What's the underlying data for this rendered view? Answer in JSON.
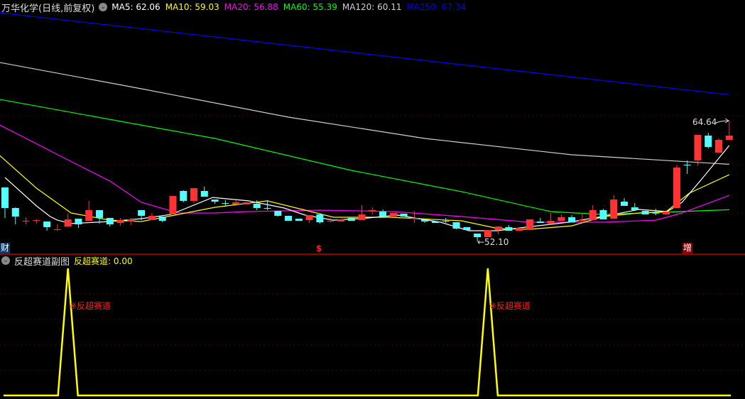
{
  "header": {
    "title": "万华化学(日线,前复权)",
    "ma": [
      {
        "label": "MA5: 62.06",
        "color": "#ffffff"
      },
      {
        "label": "MA10: 59.03",
        "color": "#ffff00"
      },
      {
        "label": "MA20: 56.88",
        "color": "#ff00ff"
      },
      {
        "label": "MA60: 55.39",
        "color": "#00ff00"
      },
      {
        "label": "MA120: 60.11",
        "color": "#d0d0d0"
      },
      {
        "label": "MA250: 67.34",
        "color": "#0000ff"
      }
    ]
  },
  "sub_header": {
    "title": "反超赛道副图",
    "indicator": "反超赛道: 0.00"
  },
  "markers": {
    "cai": "财",
    "dollar": "$",
    "zeng": "增"
  },
  "annotations": {
    "high": "64.64",
    "low": "←52.10",
    "signal_label": "※反超赛道"
  },
  "colors": {
    "up": "#ff3333",
    "down": "#54ffff",
    "grid": "#8b0000",
    "separator": "#c00000",
    "sub_line": "#ffff00"
  },
  "chart_data": {
    "type": "candlestick",
    "title": "万华化学(日线,前复权)",
    "price_range": [
      52.1,
      64.64
    ],
    "candles_ohlc": [
      [
        57.71,
        57.71,
        54.54,
        55.57
      ],
      [
        55.57,
        55.64,
        53.87,
        54.68
      ],
      [
        54.2,
        54.61,
        53.87,
        54.24
      ],
      [
        54.28,
        54.39,
        53.95,
        54.31
      ],
      [
        54.17,
        54.17,
        53.21,
        53.58
      ],
      [
        53.33,
        53.87,
        53.21,
        53.36
      ],
      [
        53.65,
        54.98,
        53.65,
        54.39
      ],
      [
        54.46,
        54.46,
        53.5,
        53.87
      ],
      [
        54.24,
        56.31,
        54.24,
        55.35
      ],
      [
        55.35,
        55.35,
        53.95,
        54.54
      ],
      [
        54.54,
        54.54,
        53.65,
        53.87
      ],
      [
        54.02,
        54.54,
        53.72,
        54.31
      ],
      [
        54.17,
        54.54,
        53.8,
        54.39
      ],
      [
        55.35,
        55.35,
        54.31,
        54.76
      ],
      [
        54.31,
        55.05,
        54.31,
        54.76
      ],
      [
        54.68,
        54.68,
        54.09,
        54.24
      ],
      [
        54.9,
        56.82,
        54.9,
        56.82
      ],
      [
        57.34,
        57.41,
        56.16,
        56.31
      ],
      [
        56.31,
        57.63,
        56.08,
        57.63
      ],
      [
        57.34,
        57.78,
        56.75,
        56.75
      ],
      [
        56.45,
        56.45,
        56.01,
        56.23
      ],
      [
        56.08,
        56.38,
        55.72,
        56.05
      ],
      [
        55.94,
        56.38,
        55.94,
        56.16
      ],
      [
        55.94,
        56.16,
        55.94,
        56.16
      ],
      [
        56.01,
        56.38,
        55.35,
        55.57
      ],
      [
        55.57,
        56.38,
        55.35,
        55.49
      ],
      [
        55.27,
        55.27,
        54.68,
        54.76
      ],
      [
        54.76,
        54.76,
        54.24,
        54.24
      ],
      [
        54.46,
        54.46,
        54.24,
        54.24
      ],
      [
        54.31,
        54.83,
        54.02,
        54.83
      ],
      [
        54.9,
        54.9,
        53.95,
        54.09
      ],
      [
        54.2,
        54.54,
        54.09,
        54.24
      ],
      [
        54.17,
        54.39,
        54.17,
        54.39
      ],
      [
        54.54,
        54.54,
        54.24,
        54.24
      ],
      [
        54.31,
        55.86,
        54.31,
        54.9
      ],
      [
        55.31,
        55.64,
        54.9,
        55.35
      ],
      [
        55.2,
        55.42,
        54.68,
        54.68
      ],
      [
        54.68,
        55.05,
        54.68,
        55.05
      ],
      [
        54.98,
        54.98,
        54.68,
        54.68
      ],
      [
        54.5,
        55.27,
        54.02,
        54.54
      ],
      [
        54.39,
        54.39,
        54.02,
        54.17
      ],
      [
        54.17,
        54.17,
        54.02,
        54.02
      ],
      [
        54.24,
        54.54,
        54.02,
        54.2
      ],
      [
        54.09,
        54.09,
        53.36,
        53.43
      ],
      [
        53.58,
        53.58,
        53.28,
        53.28
      ],
      [
        52.91,
        52.91,
        52.1,
        52.54
      ],
      [
        52.54,
        53.28,
        52.54,
        53.28
      ],
      [
        53.28,
        53.65,
        52.84,
        53.65
      ],
      [
        53.58,
        53.8,
        53.21,
        53.21
      ],
      [
        53.21,
        53.5,
        53.21,
        53.5
      ],
      [
        53.28,
        54.39,
        53.28,
        54.39
      ],
      [
        54.17,
        54.54,
        54.02,
        54.02
      ],
      [
        53.95,
        55.05,
        53.95,
        54.24
      ],
      [
        54.24,
        54.9,
        54.24,
        54.61
      ],
      [
        54.61,
        54.83,
        54.09,
        54.09
      ],
      [
        54.28,
        55.05,
        53.95,
        54.31
      ],
      [
        54.31,
        55.86,
        54.31,
        55.35
      ],
      [
        55.35,
        55.49,
        54.39,
        54.39
      ],
      [
        54.46,
        56.9,
        54.46,
        56.45
      ],
      [
        56.23,
        56.6,
        55.79,
        55.79
      ],
      [
        55.64,
        56.08,
        55.35,
        55.35
      ],
      [
        55.27,
        55.27,
        54.9,
        54.9
      ],
      [
        55.07,
        55.49,
        54.83,
        55.05
      ],
      [
        54.9,
        55.2,
        54.9,
        55.2
      ],
      [
        55.57,
        60.07,
        55.57,
        59.77
      ],
      [
        60.07,
        60.51,
        59.11,
        60.03
      ],
      [
        60.51,
        63.17,
        59.99,
        63.17
      ],
      [
        63.09,
        63.39,
        61.76,
        61.91
      ],
      [
        61.32,
        62.8,
        61.32,
        62.65
      ],
      [
        62.65,
        64.64,
        62.65,
        63.09
      ]
    ],
    "moving_averages": [
      {
        "name": "MA250",
        "color": "#0000ff",
        "points": [
          [
            -0.5,
            75.85
          ],
          [
            69,
            67.34
          ]
        ]
      },
      {
        "name": "MA120",
        "color": "#d0d0d0",
        "points": [
          [
            -0.5,
            70.69
          ],
          [
            13,
            67.96
          ],
          [
            27,
            65.01
          ],
          [
            40,
            62.8
          ],
          [
            54,
            61.1
          ],
          [
            69,
            60.11
          ]
        ]
      },
      {
        "name": "MA60",
        "color": "#00ff00",
        "points": [
          [
            -0.5,
            66.85
          ],
          [
            20,
            62.8
          ],
          [
            33,
            59.48
          ],
          [
            43.5,
            57.27
          ],
          [
            52,
            55.2
          ],
          [
            57,
            54.9
          ],
          [
            69,
            55.39
          ]
        ]
      },
      {
        "name": "MA20",
        "color": "#ff00ff",
        "points": [
          [
            -0.5,
            64.2
          ],
          [
            6,
            60.58
          ],
          [
            10,
            58.37
          ],
          [
            13,
            56.16
          ],
          [
            16.5,
            55.05
          ],
          [
            20,
            55.05
          ],
          [
            23,
            55.2
          ],
          [
            30,
            55.35
          ],
          [
            37,
            55.2
          ],
          [
            43.5,
            54.68
          ],
          [
            50,
            54.09
          ],
          [
            57,
            54.09
          ],
          [
            62,
            54.31
          ],
          [
            64.5,
            55.05
          ],
          [
            69,
            56.88
          ]
        ]
      },
      {
        "name": "MA10",
        "color": "#ffff00",
        "points": [
          [
            -0.5,
            61.03
          ],
          [
            3,
            57.63
          ],
          [
            6.3,
            55.05
          ],
          [
            10,
            54.31
          ],
          [
            13,
            54.17
          ],
          [
            16.5,
            54.9
          ],
          [
            20,
            55.64
          ],
          [
            25,
            56.31
          ],
          [
            28.6,
            55.35
          ],
          [
            31.3,
            54.61
          ],
          [
            36.7,
            54.61
          ],
          [
            43.5,
            54.24
          ],
          [
            47,
            53.43
          ],
          [
            50,
            53.36
          ],
          [
            54,
            53.72
          ],
          [
            57,
            54.68
          ],
          [
            60.4,
            55.05
          ],
          [
            63,
            55.2
          ],
          [
            65.2,
            57.12
          ],
          [
            69,
            59.03
          ]
        ]
      },
      {
        "name": "MA5",
        "color": "#ffffff",
        "points": [
          [
            0,
            58.74
          ],
          [
            3,
            55.79
          ],
          [
            4.3,
            54.68
          ],
          [
            5,
            54.31
          ],
          [
            6.3,
            53.95
          ],
          [
            10,
            54.17
          ],
          [
            13,
            54.46
          ],
          [
            15.8,
            54.9
          ],
          [
            19.8,
            56.67
          ],
          [
            23.2,
            56.31
          ],
          [
            26.6,
            55.57
          ],
          [
            28.6,
            54.83
          ],
          [
            31.3,
            54.31
          ],
          [
            34.7,
            54.54
          ],
          [
            37.4,
            54.83
          ],
          [
            41.5,
            54.09
          ],
          [
            44.2,
            53.21
          ],
          [
            46.9,
            53.21
          ],
          [
            49.6,
            53.58
          ],
          [
            53.7,
            54.09
          ],
          [
            57.7,
            54.83
          ],
          [
            60.4,
            55.42
          ],
          [
            63.1,
            55.2
          ],
          [
            64.5,
            56.16
          ],
          [
            66.5,
            58.74
          ],
          [
            69,
            62.06
          ]
        ]
      }
    ],
    "sub_indicator": {
      "name": "反超赛道",
      "signal_indices": [
        6,
        46
      ],
      "ylim": [
        0,
        1
      ]
    }
  }
}
